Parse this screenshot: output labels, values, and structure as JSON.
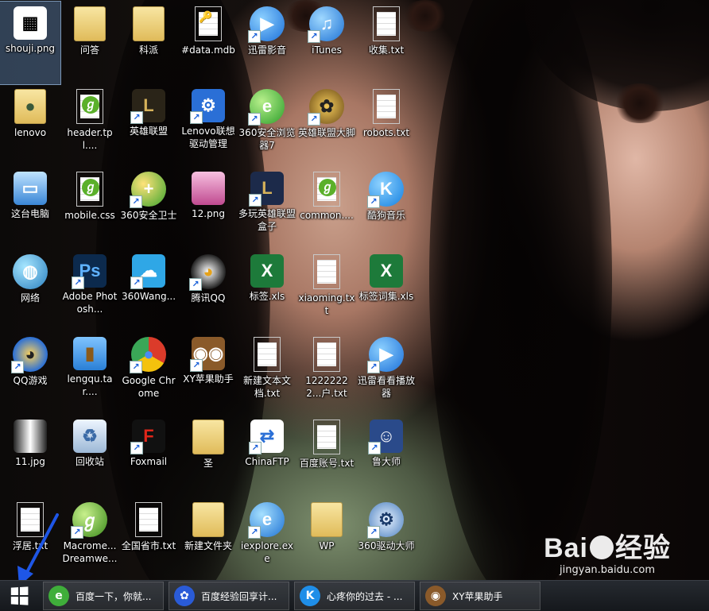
{
  "icons": [
    {
      "label": "shouji.png",
      "kind": "qr"
    },
    {
      "label": "问答",
      "kind": "folder"
    },
    {
      "label": "科派",
      "kind": "folder"
    },
    {
      "label": "#data.mdb",
      "kind": "mdb"
    },
    {
      "label": "迅雷影音",
      "kind": "xunlei"
    },
    {
      "label": "iTunes",
      "kind": "itunes"
    },
    {
      "label": "收集.txt",
      "kind": "file"
    },
    {
      "label": "lenovo",
      "kind": "user-folder"
    },
    {
      "label": "header.tpl....",
      "kind": "dw"
    },
    {
      "label": "英雄联盟",
      "kind": "lol"
    },
    {
      "label": "Lenovo联想驱动管理",
      "kind": "lenovo"
    },
    {
      "label": "360安全浏览器7",
      "kind": "ie360"
    },
    {
      "label": "英雄联盟大脚",
      "kind": "paw"
    },
    {
      "label": "robots.txt",
      "kind": "file"
    },
    {
      "label": "这台电脑",
      "kind": "pc"
    },
    {
      "label": "mobile.css",
      "kind": "dw"
    },
    {
      "label": "360安全卫士",
      "kind": "s360"
    },
    {
      "label": "12.png",
      "kind": "png"
    },
    {
      "label": "多玩英雄联盟盒子",
      "kind": "box"
    },
    {
      "label": "common....",
      "kind": "dw"
    },
    {
      "label": "酷狗音乐",
      "kind": "kugou"
    },
    {
      "label": "网络",
      "kind": "net"
    },
    {
      "label": "Adobe Photosh...",
      "kind": "ps"
    },
    {
      "label": "360Wang...",
      "kind": "cloud"
    },
    {
      "label": "腾讯QQ",
      "kind": "qq"
    },
    {
      "label": "标签.xls",
      "kind": "xls"
    },
    {
      "label": "xiaoming.txt",
      "kind": "file"
    },
    {
      "label": "标签词集.xls",
      "kind": "xls"
    },
    {
      "label": "QQ游戏",
      "kind": "qqgame"
    },
    {
      "label": "lengqu.tar....",
      "kind": "tar"
    },
    {
      "label": "Google Chrome",
      "kind": "chrome"
    },
    {
      "label": "XY苹果助手",
      "kind": "owl"
    },
    {
      "label": "新建文本文档.txt",
      "kind": "file"
    },
    {
      "label": "12222222...户.txt",
      "kind": "file"
    },
    {
      "label": "迅雷看看播放器",
      "kind": "xunlei"
    },
    {
      "label": "11.jpg",
      "kind": "jpg"
    },
    {
      "label": "回收站",
      "kind": "bin"
    },
    {
      "label": "Foxmail",
      "kind": "foxmail"
    },
    {
      "label": "圣",
      "kind": "folder2"
    },
    {
      "label": "ChinaFTP",
      "kind": "ftp"
    },
    {
      "label": "百度账号.txt",
      "kind": "file"
    },
    {
      "label": "鲁大师",
      "kind": "ludashi"
    },
    {
      "label": "浮居.txt",
      "kind": "file"
    },
    {
      "label": "Macrome... Dreamwe...",
      "kind": "dwapp"
    },
    {
      "label": "全国省市.txt",
      "kind": "file"
    },
    {
      "label": "新建文件夹",
      "kind": "folder2"
    },
    {
      "label": "iexplore.exe",
      "kind": "ie"
    },
    {
      "label": "WP",
      "kind": "folder2"
    },
    {
      "label": "360驱动大师",
      "kind": "gear360"
    }
  ],
  "taskbar": {
    "items": [
      {
        "label": "百度一下，你就...",
        "icon": "ie360-icon",
        "color": "#3fae3a",
        "glyph": "e"
      },
      {
        "label": "百度经验回享计...",
        "icon": "baidu-paw-icon",
        "color": "#2a5bd7",
        "glyph": "✿"
      },
      {
        "label": "心疼你的过去 - ...",
        "icon": "kugou-icon",
        "color": "#1f8ee8",
        "glyph": "K"
      },
      {
        "label": "XY苹果助手",
        "icon": "owl-icon",
        "color": "#8a5a2a",
        "glyph": "◉"
      }
    ]
  },
  "watermark": {
    "brand_left": "Bai",
    "brand_right": "经验",
    "url": "jingyan.baidu.com"
  },
  "colors": {
    "arrow": "#1e56e6",
    "taskbar": "#1b1e23"
  }
}
